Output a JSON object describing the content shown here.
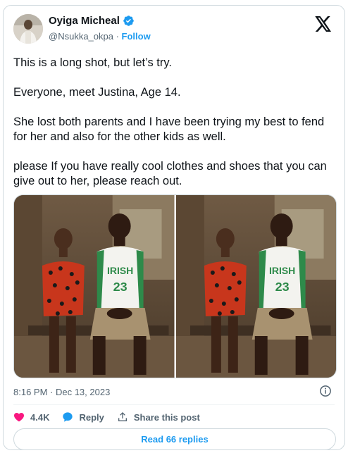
{
  "author": {
    "name": "Oyiga Micheal",
    "handle": "@Nsukka_okpa",
    "separator": " · ",
    "follow_label": "Follow"
  },
  "tweet": {
    "paragraphs": [
      "This is a long shot, but let’s try.",
      "Everyone, meet Justina, Age 14.",
      "She lost both parents and I have been trying my best to fend for her and also for the other kids as well.",
      "please If you have really cool clothes and shoes that you can give out to her, please reach out."
    ],
    "jersey_text": "IRISH",
    "jersey_number": "23"
  },
  "meta": {
    "timestamp": "8:16 PM · Dec 13, 2023"
  },
  "actions": {
    "likes": "4.4K",
    "reply_label": "Reply",
    "share_label": "Share this post",
    "read_replies_label": "Read 66 replies"
  },
  "colors": {
    "accent": "#1d9bf0",
    "like": "#f91880",
    "muted": "#536471",
    "border": "#cfd9de"
  },
  "icons": [
    "verified-badge-icon",
    "x-logo-icon",
    "info-icon",
    "heart-icon",
    "reply-bubble-icon",
    "share-upload-icon"
  ]
}
